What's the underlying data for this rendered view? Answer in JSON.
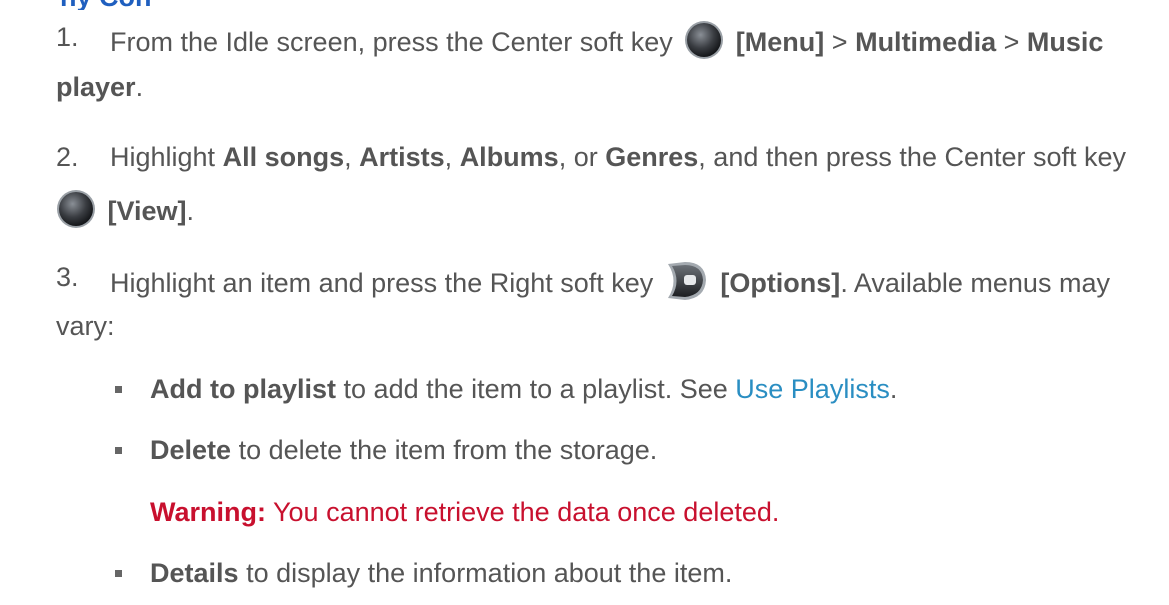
{
  "partial_heading": "ny Con",
  "steps": [
    {
      "number": "1.",
      "text_before": "From the Idle screen, press the Center soft key",
      "key_label": "[Menu]",
      "separator": ">",
      "item_1": "Multimedia",
      "item_2_line1": "Music",
      "item_2_line2": "player",
      "text_after": "."
    },
    {
      "number": "2.",
      "text_1": "Highlight",
      "opt_1": "All songs",
      "comma": ",",
      "opt_2": "Artists",
      "opt_3": "Albums",
      "text_or": ", or",
      "opt_4": "Genres",
      "text_2": ", and then press the Center soft key",
      "key_label": "[View]",
      "text_after": "."
    },
    {
      "number": "3.",
      "text_1": "Highlight an item and press the Right soft key",
      "key_label": "[Options]",
      "text_2": ". Available menus may",
      "text_3": "vary:"
    }
  ],
  "options": [
    {
      "label": "Add to playlist",
      "desc": "to add the item to a playlist. See",
      "link": "Use Playlists",
      "end": "."
    },
    {
      "label": "Delete",
      "desc": "to delete the item from the storage."
    },
    {
      "label": "Details",
      "desc": "to display the information about the item."
    }
  ],
  "warning": {
    "label": "Warning:",
    "text": "You cannot retrieve the data once deleted."
  },
  "colors": {
    "text": "#555555",
    "link": "#2a8ec2",
    "warning": "#c8102e",
    "heading": "#1f5fbf"
  },
  "icons": {
    "center_key": "center-soft-key-icon",
    "right_key": "right-soft-key-icon"
  }
}
